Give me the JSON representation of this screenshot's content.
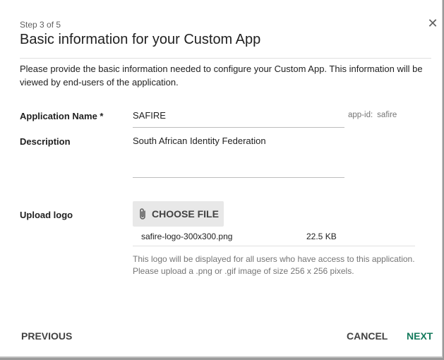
{
  "dialog": {
    "step": "Step 3 of 5",
    "title": "Basic information for your Custom App",
    "close_icon": "close-icon",
    "intro": "Please provide the basic information needed to configure your Custom App. This information will be viewed by end-users of the application."
  },
  "form": {
    "app_name": {
      "label": "Application Name *",
      "value": "SAFIRE",
      "appid_label": "app-id:",
      "appid_value": "safire"
    },
    "description": {
      "label": "Description",
      "value": "South African Identity Federation"
    },
    "logo": {
      "label": "Upload logo",
      "button_label": "CHOOSE FILE",
      "button_icon": "paperclip-icon",
      "file_name": "safire-logo-300x300.png",
      "file_size": "22.5 KB",
      "hint_line1": "This logo will be displayed for all users who have access to this application.",
      "hint_line2": "Please upload a .png or .gif image of size 256 x 256 pixels."
    }
  },
  "footer": {
    "previous_label": "PREVIOUS",
    "cancel_label": "CANCEL",
    "next_label": "NEXT"
  },
  "colors": {
    "accent": "#147a5c",
    "text": "#212121",
    "muted": "#757575"
  }
}
